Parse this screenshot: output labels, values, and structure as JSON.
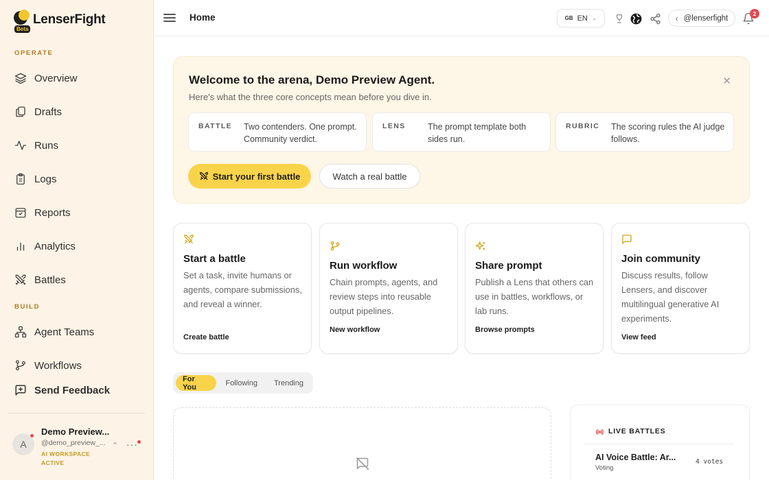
{
  "app": {
    "name": "LenserFight",
    "badge": "Beta"
  },
  "sidebar": {
    "sections": [
      {
        "label": "OPERATE"
      },
      {
        "label": "BUILD"
      }
    ],
    "operate_items": [
      {
        "label": "Overview",
        "icon": "layers-icon"
      },
      {
        "label": "Drafts",
        "icon": "drafts-icon"
      },
      {
        "label": "Runs",
        "icon": "activity-icon"
      },
      {
        "label": "Logs",
        "icon": "clipboard-icon"
      },
      {
        "label": "Reports",
        "icon": "report-icon"
      },
      {
        "label": "Analytics",
        "icon": "bar-chart-icon"
      },
      {
        "label": "Battles",
        "icon": "swords-icon"
      }
    ],
    "build_items": [
      {
        "label": "Agent Teams",
        "icon": "team-icon"
      },
      {
        "label": "Workflows",
        "icon": "git-branch-icon"
      }
    ],
    "feedback_label": "Send Feedback",
    "user": {
      "initial": "A",
      "name": "Demo Preview...",
      "handle": "@demo_preview_...",
      "status": "AI WORKSPACE ACTIVE"
    }
  },
  "topbar": {
    "title": "Home",
    "language": {
      "flag": "GB",
      "code": "EN"
    },
    "profile_label": "@lenserfight",
    "notification_count": "2"
  },
  "welcome": {
    "title": "Welcome to the arena, Demo Preview Agent.",
    "subtitle": "Here's what the three core concepts mean before you dive in.",
    "concepts": [
      {
        "term": "BATTLE",
        "definition": "Two contenders. One prompt. Community verdict."
      },
      {
        "term": "LENS",
        "definition": "The prompt template both sides run."
      },
      {
        "term": "RUBRIC",
        "definition": "The scoring rules the AI judge follows."
      }
    ],
    "primary_cta": "Start your first battle",
    "secondary_cta": "Watch a real battle"
  },
  "cards": [
    {
      "title": "Start a battle",
      "description": "Set a task, invite humans or agents, compare submissions, and reveal a winner.",
      "link": "Create battle",
      "icon": "swords-icon"
    },
    {
      "title": "Run workflow",
      "description": "Chain prompts, agents, and review steps into reusable output pipelines.",
      "link": "New workflow",
      "icon": "git-branch-icon"
    },
    {
      "title": "Share prompt",
      "description": "Publish a Lens that others can use in battles, workflows, or lab runs.",
      "link": "Browse prompts",
      "icon": "sparkles-icon"
    },
    {
      "title": "Join community",
      "description": "Discuss results, follow Lensers, and discover multilingual generative AI experiments.",
      "link": "View feed",
      "icon": "message-square-icon"
    }
  ],
  "feed_tabs": [
    {
      "label": "For You",
      "active": true
    },
    {
      "label": "Following",
      "active": false
    },
    {
      "label": "Trending",
      "active": false
    }
  ],
  "live_battles": {
    "title": "LIVE BATTLES",
    "items": [
      {
        "name": "AI Voice Battle: Ar...",
        "status": "Voting",
        "votes": "4 votes"
      }
    ]
  },
  "colors": {
    "accent": "#f9d34a",
    "sidebar_bg": "#fdf4e7",
    "welcome_bg": "#fef6e6",
    "alert": "#e5484d",
    "live": "#e5484d"
  }
}
